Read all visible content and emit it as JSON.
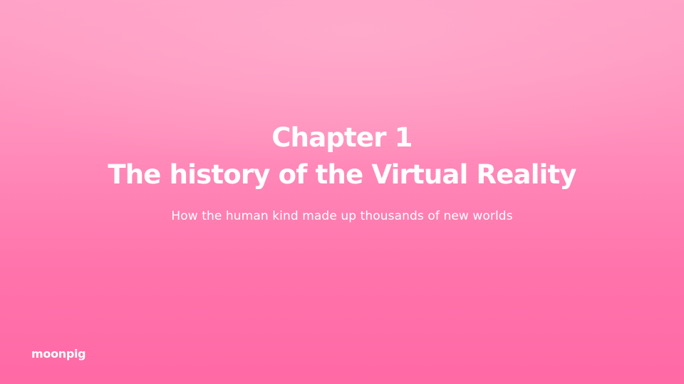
{
  "slide": {
    "title_line1": "Chapter 1",
    "title_line2": "The history of the Virtual Reality",
    "subtitle": "How the human kind made up thousands of new worlds",
    "logo_text": "moonpig"
  },
  "colors": {
    "background_top": "#ffa0c6",
    "background_bottom": "#ff69a5",
    "text": "#ffffff"
  }
}
